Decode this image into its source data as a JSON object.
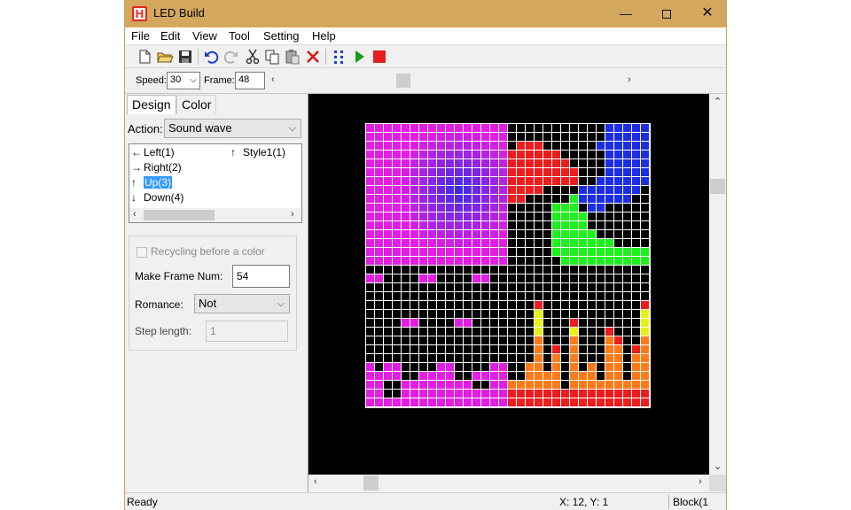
{
  "window": {
    "title": "LED Build",
    "minimize_glyph": "—",
    "close_glyph": "✕"
  },
  "menu": [
    "File",
    "Edit",
    "View",
    "Tool",
    "Setting",
    "Help"
  ],
  "toolbar": {
    "icons": [
      "new-icon",
      "open-icon",
      "save-icon",
      "undo-icon",
      "redo-icon",
      "cut-icon",
      "copy-icon",
      "paste-icon",
      "delete-icon",
      "grid-icon",
      "play-icon",
      "stop-icon"
    ],
    "colors": {
      "play": "#1a9a1a",
      "stop": "#e81c1c",
      "delete": "#d01818",
      "grid": "#1c3fd6"
    }
  },
  "controlbar": {
    "speed_label": "Speed:",
    "speed_value": "30",
    "frame_label": "Frame:",
    "frame_value": "48"
  },
  "left_panel": {
    "tabs": [
      "Design",
      "Color"
    ],
    "action_label": "Action:",
    "action_value": "Sound wave",
    "list_items": [
      {
        "arrow": "←",
        "label": "Left(1)"
      },
      {
        "arrow": "→",
        "label": "Right(2)"
      },
      {
        "arrow": "↑",
        "label": "Up(3)",
        "selected": true
      },
      {
        "arrow": "↓",
        "label": "Down(4)"
      },
      {
        "arrow": "↑",
        "label": "Style1(1)"
      }
    ],
    "recycling_label": "Recycling before a color",
    "make_frame_label": "Make Frame Num:",
    "make_frame_value": "54",
    "romance_label": "Romance:",
    "romance_value": "Not",
    "step_label": "Step length:",
    "step_value": "1"
  },
  "status": {
    "text": "Ready",
    "coords": "X: 12, Y: 1",
    "block": "Block(1"
  },
  "matrix": {
    "cols": 32,
    "rows": 32,
    "colors": {
      "background": "#000000",
      "grid": "#ffffff",
      "magenta": "#e51ce5",
      "red": "#ee1c1c",
      "blue": "#1c2ee5",
      "green": "#1cf21c",
      "orange": "#ff7a18",
      "yellow": "#e8f018"
    }
  }
}
